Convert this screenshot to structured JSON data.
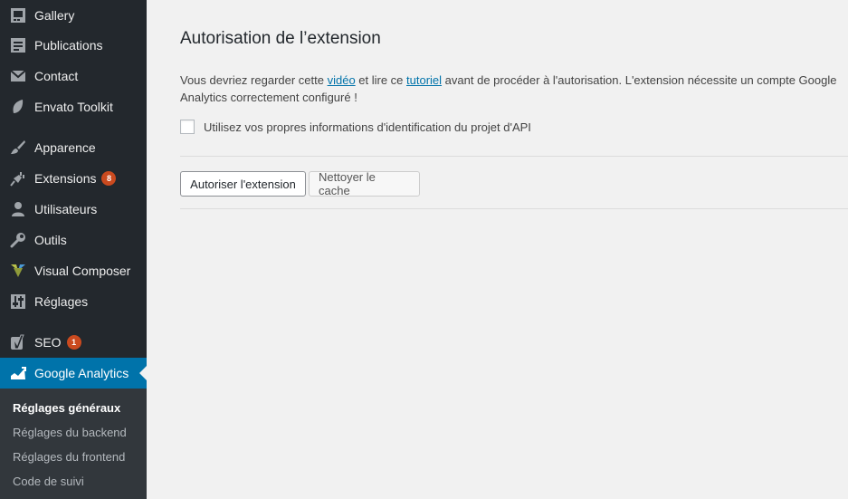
{
  "sidebar": {
    "items": [
      {
        "label": "Gallery",
        "icon": "gallery-icon"
      },
      {
        "label": "Publications",
        "icon": "publications-icon"
      },
      {
        "label": "Contact",
        "icon": "mail-icon"
      },
      {
        "label": "Envato Toolkit",
        "icon": "leaf-icon"
      },
      {
        "label": "Apparence",
        "icon": "paintbrush-icon"
      },
      {
        "label": "Extensions",
        "icon": "plugin-icon",
        "badge": "8"
      },
      {
        "label": "Utilisateurs",
        "icon": "user-icon"
      },
      {
        "label": "Outils",
        "icon": "wrench-icon"
      },
      {
        "label": "Visual Composer",
        "icon": "visual-composer-icon"
      },
      {
        "label": "Réglages",
        "icon": "settings-icon"
      },
      {
        "label": "SEO",
        "icon": "yoast-icon",
        "badge": "1"
      },
      {
        "label": "Google Analytics",
        "icon": "analytics-icon",
        "active": true
      }
    ],
    "submenu": [
      {
        "label": "Réglages généraux",
        "current": true
      },
      {
        "label": "Réglages du backend"
      },
      {
        "label": "Réglages du frontend"
      },
      {
        "label": "Code de suivi"
      }
    ]
  },
  "main": {
    "title": "Autorisation de l’extension",
    "desc_part1": "Vous devriez regarder cette ",
    "desc_link1": "vidéo",
    "desc_part2": " et lire ce ",
    "desc_link2": "tutoriel",
    "desc_part3": " avant de procéder à l'autorisation. L'extension nécessite un compte Google Analytics correctement configuré !",
    "checkbox_label": "Utilisez vos propres informations d'identification du projet d'API",
    "checkbox_checked": false,
    "authorize_button": "Autoriser l'extension",
    "clear_cache_button": "Nettoyer le cache"
  },
  "colors": {
    "sidebar_bg": "#23282d",
    "submenu_bg": "#32373c",
    "active_bg": "#0073aa",
    "badge_bg": "#ca4a1f",
    "link": "#0073aa"
  }
}
